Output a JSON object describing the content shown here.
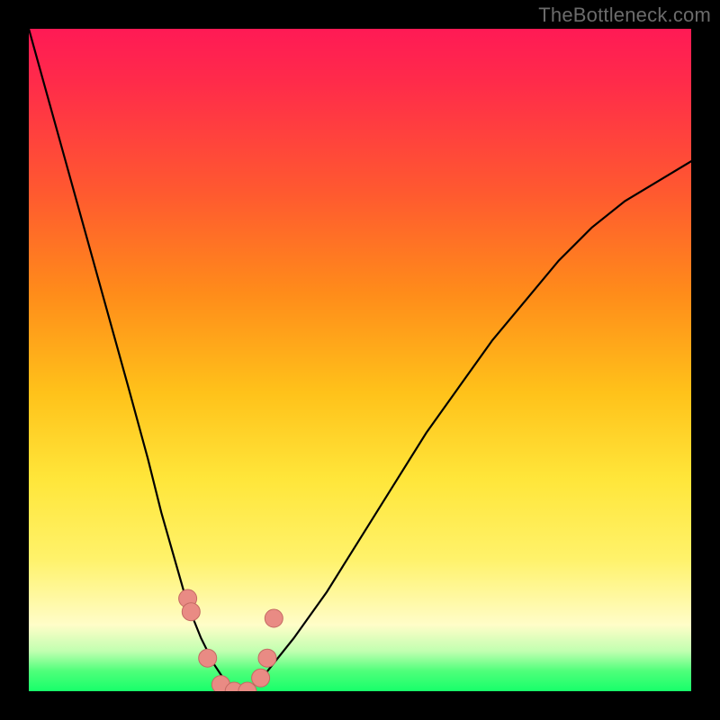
{
  "watermark": "TheBottleneck.com",
  "colors": {
    "frame": "#000000",
    "curve": "#000000",
    "marker_fill": "#e98b84",
    "marker_stroke": "#c46a63",
    "gradient_stops": [
      "#ff1a55",
      "#ff5a2f",
      "#ffc21a",
      "#fff26a",
      "#fffdc8",
      "#4eff7a",
      "#17ff6a"
    ]
  },
  "chart_data": {
    "type": "line",
    "title": "",
    "xlabel": "",
    "ylabel": "",
    "xlim": [
      0,
      100
    ],
    "ylim": [
      0,
      100
    ],
    "series": [
      {
        "name": "bottleneck-curve",
        "x": [
          0,
          5,
          10,
          15,
          18,
          20,
          22,
          24,
          26,
          28,
          30,
          32,
          34,
          36,
          40,
          45,
          50,
          55,
          60,
          65,
          70,
          75,
          80,
          85,
          90,
          95,
          100
        ],
        "values": [
          100,
          82,
          64,
          46,
          35,
          27,
          20,
          13,
          8,
          4,
          1,
          0,
          1,
          3,
          8,
          15,
          23,
          31,
          39,
          46,
          53,
          59,
          65,
          70,
          74,
          77,
          80
        ]
      }
    ],
    "markers": {
      "name": "highlighted-points",
      "x": [
        24,
        24.5,
        27,
        29,
        31,
        33,
        35,
        36,
        37
      ],
      "values": [
        14,
        12,
        5,
        1,
        0,
        0,
        2,
        5,
        11
      ]
    }
  }
}
